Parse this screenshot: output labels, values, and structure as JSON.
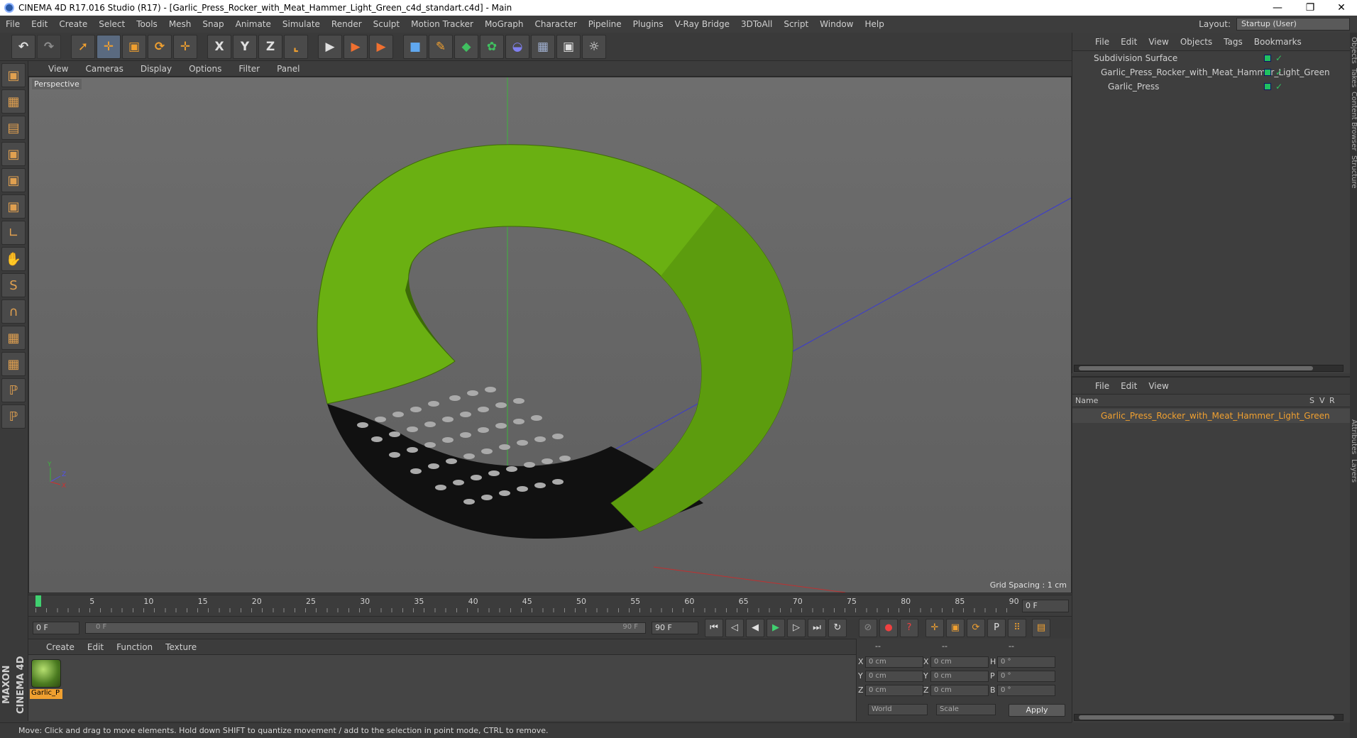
{
  "app": {
    "title": "CINEMA 4D R17.016 Studio (R17) - [Garlic_Press_Rocker_with_Meat_Hammer_Light_Green_c4d_standart.c4d] - Main",
    "window_controls": [
      "—",
      "❐",
      "✕"
    ]
  },
  "menubar": [
    "File",
    "Edit",
    "Create",
    "Select",
    "Tools",
    "Mesh",
    "Snap",
    "Animate",
    "Simulate",
    "Render",
    "Sculpt",
    "Motion Tracker",
    "MoGraph",
    "Character",
    "Pipeline",
    "Plugins",
    "V-Ray Bridge",
    "3DToAll",
    "Script",
    "Window",
    "Help"
  ],
  "layout": {
    "label": "Layout:",
    "value": "Startup (User)"
  },
  "toolbar": {
    "undo": "↶",
    "redo": "↷",
    "select": "➚",
    "move": "✛",
    "scale": "▣",
    "rotate": "⟳",
    "transform": "✛",
    "axis_x": "X",
    "axis_y": "Y",
    "axis_z": "Z",
    "coord": "⌞",
    "render_view": "▶",
    "render": "▶",
    "render_settings": "▶",
    "cube": "■",
    "pen": "✎",
    "subdiv": "◆",
    "array": "✿",
    "deformer": "◒",
    "floor": "▦",
    "camera": "▣",
    "light": "☼"
  },
  "lefttools": [
    "▣",
    "▦",
    "▤",
    "▣",
    "▣",
    "▣",
    "∟",
    "✋",
    "S",
    "∩",
    "▦",
    "▦",
    "ℙ",
    "ℙ"
  ],
  "viewport_menu": [
    "View",
    "Cameras",
    "Display",
    "Options",
    "Filter",
    "Panel"
  ],
  "viewport": {
    "label": "Perspective",
    "grid_spacing": "Grid Spacing : 1 cm",
    "axis_y": "Y",
    "axis_z": "Z",
    "axis_x": "X"
  },
  "timeline": {
    "ticks": [
      "0",
      "5",
      "10",
      "15",
      "20",
      "25",
      "30",
      "35",
      "40",
      "45",
      "50",
      "55",
      "60",
      "65",
      "70",
      "75",
      "80",
      "85",
      "90"
    ],
    "current_frame": "0 F"
  },
  "transport": {
    "start": "0 F",
    "range_start": "0 F",
    "range_end": "90 F",
    "end": "90 F",
    "buttons": [
      "⏮",
      "◁",
      "◀",
      "▶",
      "▷",
      "⏭",
      "↻"
    ]
  },
  "material_menu": [
    "Create",
    "Edit",
    "Function",
    "Texture"
  ],
  "material": {
    "name": "Garlic_P"
  },
  "coords": {
    "header": [
      "--",
      "--",
      "--"
    ],
    "rows": [
      {
        "a": "X",
        "av": "0 cm",
        "b": "X",
        "bv": "0 cm",
        "c": "H",
        "cv": "0 °"
      },
      {
        "a": "Y",
        "av": "0 cm",
        "b": "Y",
        "bv": "0 cm",
        "c": "P",
        "cv": "0 °"
      },
      {
        "a": "Z",
        "av": "0 cm",
        "b": "Z",
        "bv": "0 cm",
        "c": "B",
        "cv": "0 °"
      }
    ],
    "world": "World",
    "scale": "Scale",
    "apply": "Apply"
  },
  "brand": "MAXON CINEMA 4D",
  "status": "Move: Click and drag to move elements. Hold down SHIFT to quantize movement / add to the selection in point mode, CTRL to remove.",
  "object_manager": {
    "menu": [
      "File",
      "Edit",
      "View",
      "Objects",
      "Tags",
      "Bookmarks"
    ],
    "objects": [
      {
        "name": "Subdivision Surface",
        "indent": 0
      },
      {
        "name": "Garlic_Press_Rocker_with_Meat_Hammer_Light_Green",
        "indent": 1
      },
      {
        "name": "Garlic_Press",
        "indent": 2
      }
    ]
  },
  "attribute_manager": {
    "menu": [
      "File",
      "Edit",
      "View"
    ],
    "columns": [
      "Name",
      "S",
      "V",
      "R"
    ],
    "row": "Garlic_Press_Rocker_with_Meat_Hammer_Light_Green"
  },
  "side_tabs": [
    "Objects",
    "Takes",
    "Content Browser",
    "Structure"
  ],
  "side_tabs2": [
    "Attributes",
    "Layers"
  ],
  "colors": {
    "accent": "#f0a030",
    "object_green": "#20c060",
    "model_green": "#6ab012"
  }
}
